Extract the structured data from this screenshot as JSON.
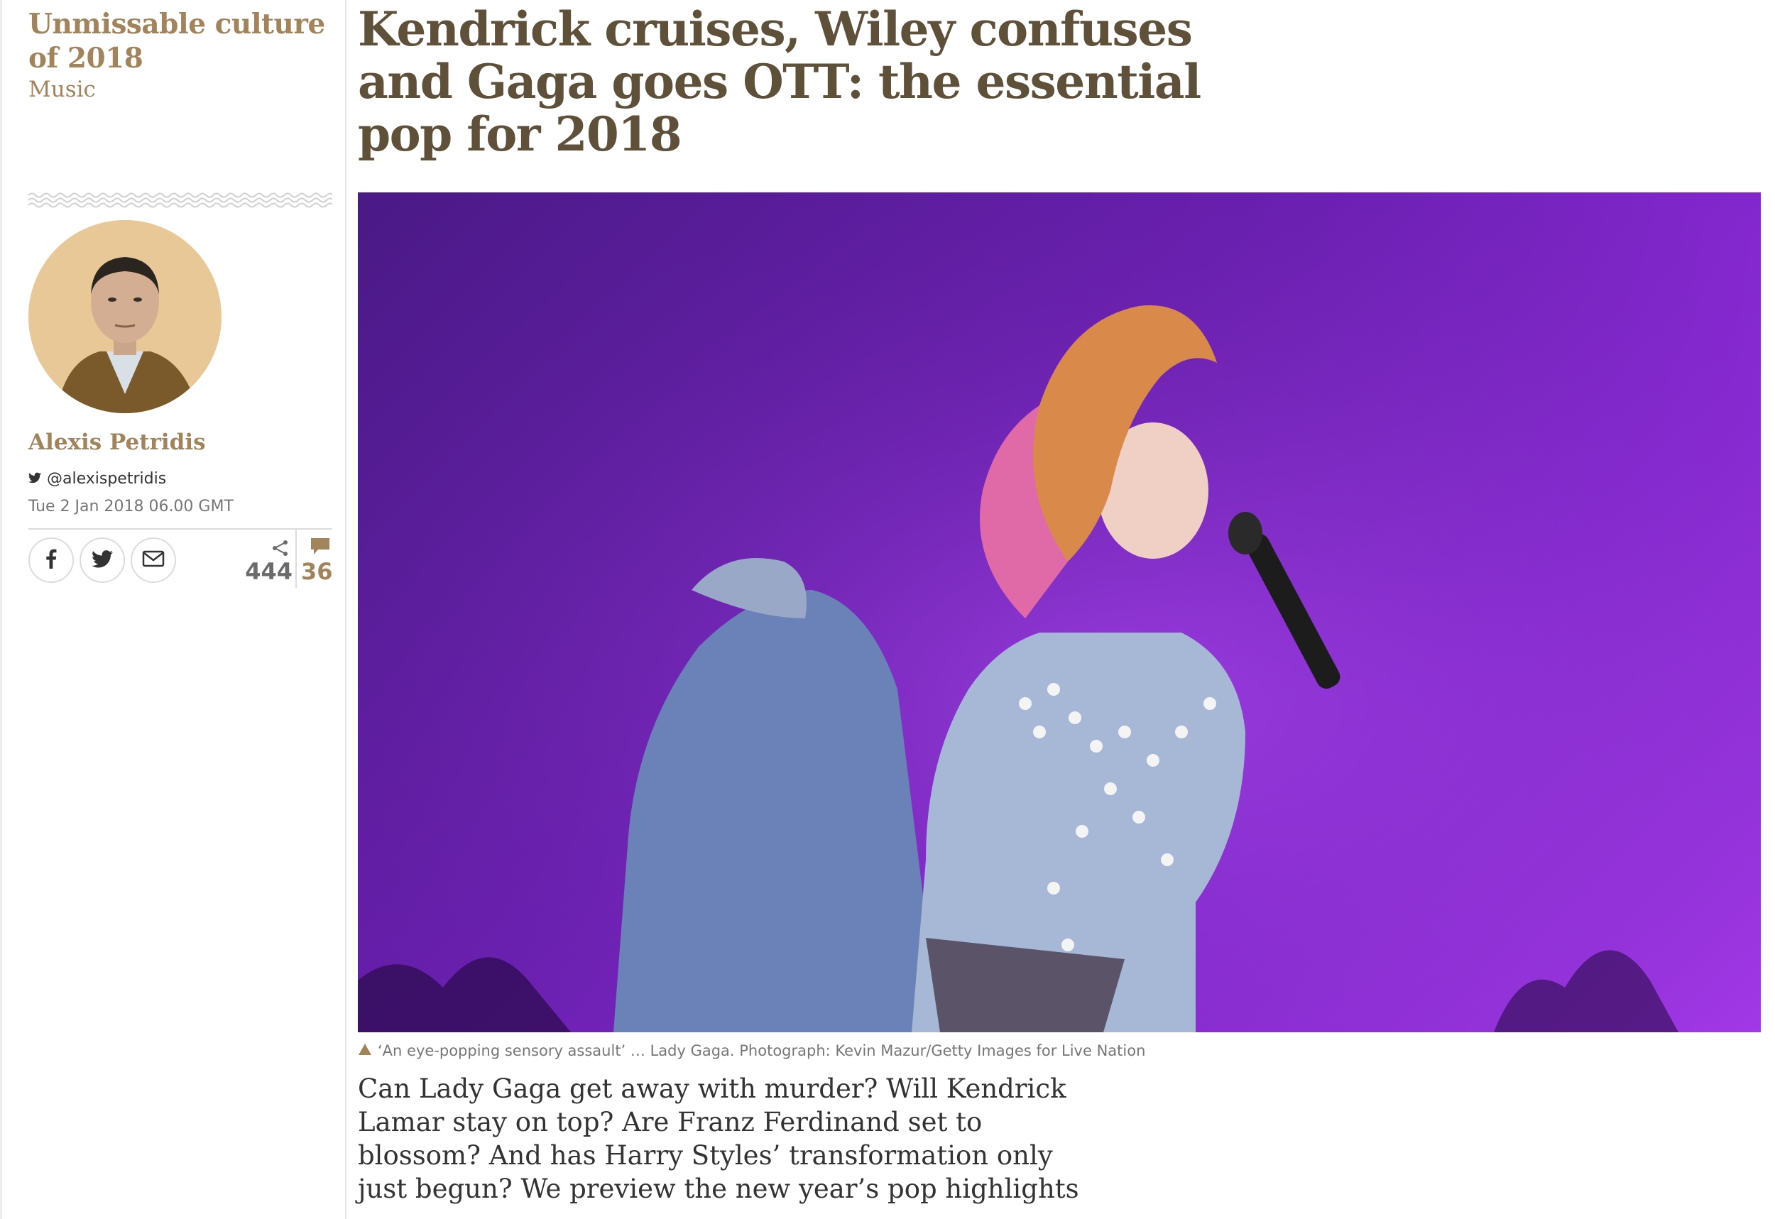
{
  "series": {
    "title": "Unmissable culture of 2018",
    "section": "Music"
  },
  "author": {
    "name": "Alexis Petridis",
    "twitter_handle": "@alexispetridis",
    "published": "Tue 2 Jan 2018 06.00 GMT"
  },
  "share": {
    "buttons": [
      {
        "label": "facebook",
        "icon": "facebook-icon"
      },
      {
        "label": "twitter",
        "icon": "twitter-icon"
      },
      {
        "label": "email",
        "icon": "email-icon"
      }
    ],
    "share_count": "444",
    "comment_count": "36"
  },
  "article": {
    "headline": "Kendrick cruises, Wiley confuses and Gaga goes OTT: the essential pop for 2018",
    "caption": "‘An eye-popping sensory assault’ … Lady Gaga. Photograph: Kevin Mazur/Getty Images for Live Nation",
    "standfirst": "Can Lady Gaga get away with murder? Will Kendrick Lamar stay on top? Are Franz Ferdinand set to blossom? And has Harry Styles’ transformation only just begun? We preview the new year’s pop highlights"
  },
  "colors": {
    "accent": "#a1845c",
    "headline": "#5f5139",
    "hero_background": "#7a22c4"
  }
}
